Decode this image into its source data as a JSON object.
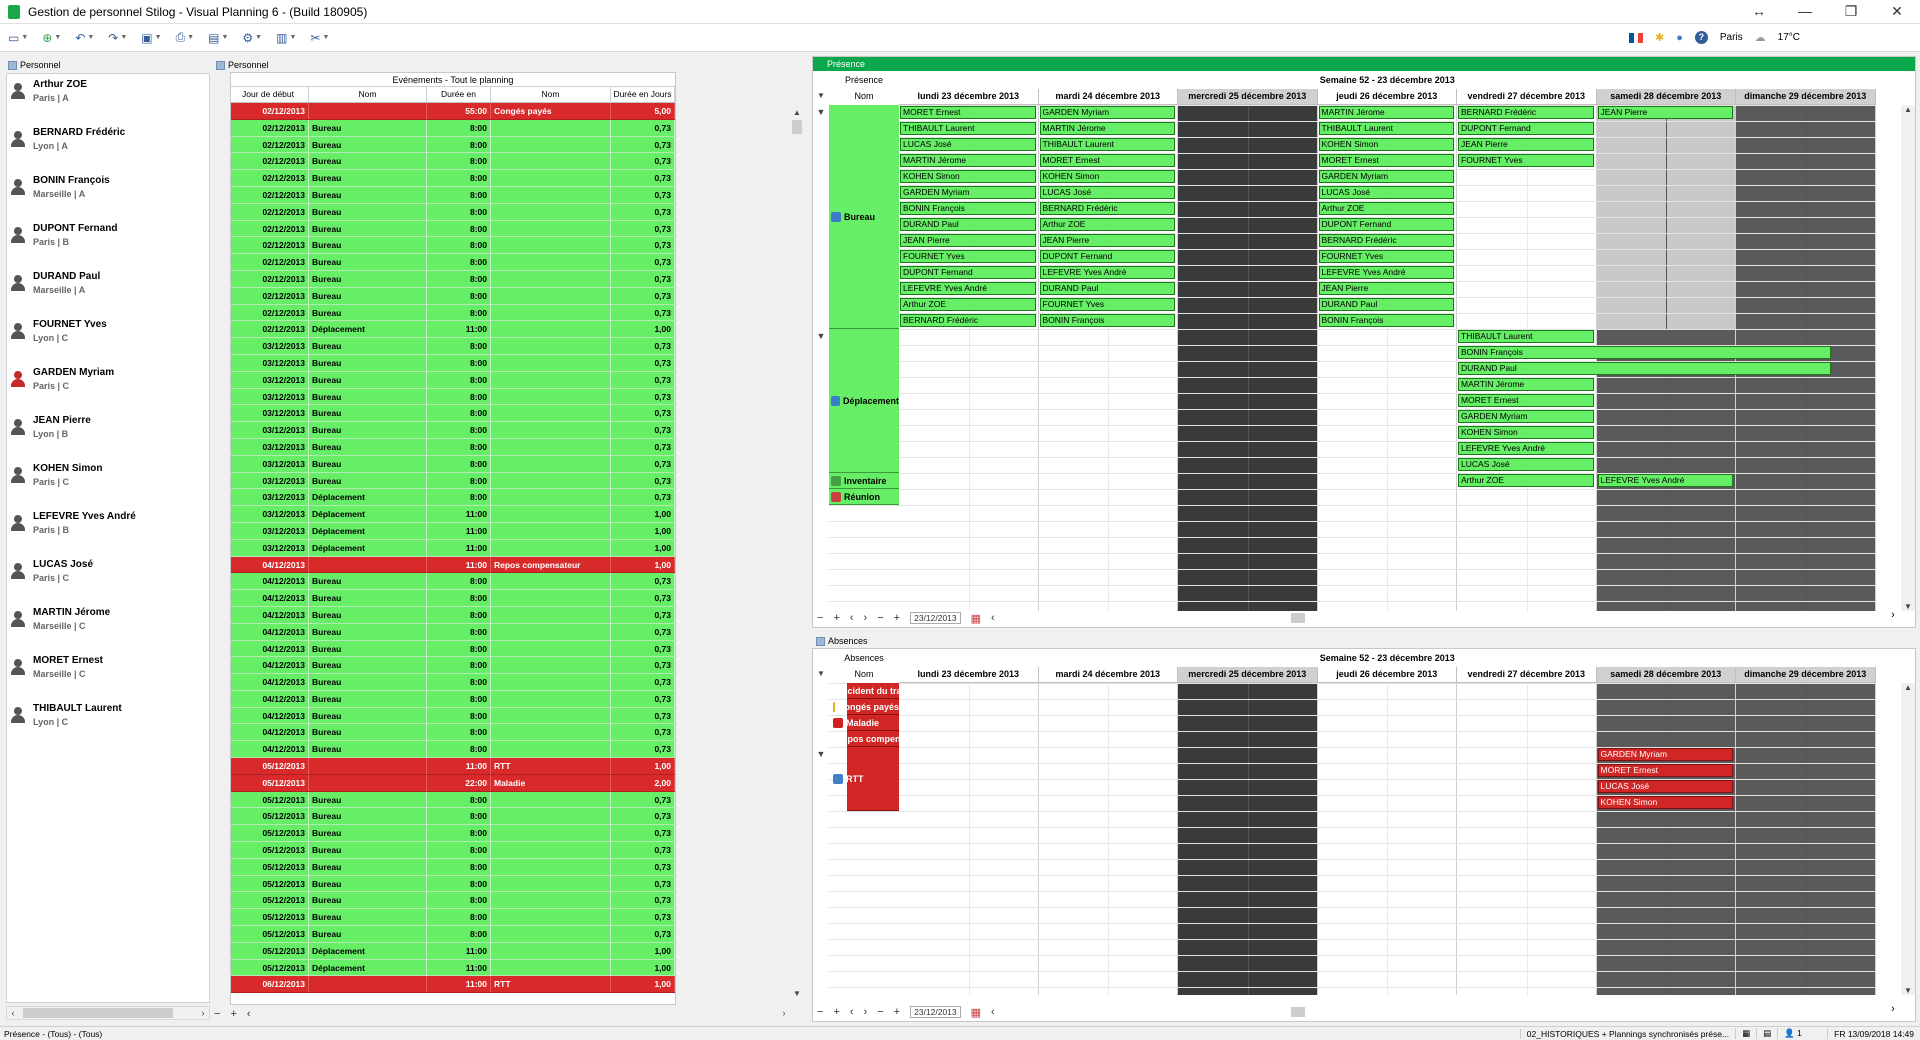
{
  "window": {
    "title": "Gestion de personnel Stilog - Visual Planning 6 - (Build 180905)",
    "controls": [
      "↔",
      "—",
      "❐",
      "✕"
    ]
  },
  "toolbar": {
    "city": "Paris",
    "temperature": "17°C",
    "help": "?"
  },
  "left_panel": {
    "title": "Personnel"
  },
  "personnel": [
    {
      "name": "Arthur ZOE",
      "loc": "Paris | A",
      "red": false
    },
    {
      "name": "BERNARD Frédéric",
      "loc": "Lyon | A",
      "red": false
    },
    {
      "name": "BONIN François",
      "loc": "Marseille | A",
      "red": false
    },
    {
      "name": "DUPONT Fernand",
      "loc": "Paris | B",
      "red": false
    },
    {
      "name": "DURAND Paul",
      "loc": "Marseille | A",
      "red": false
    },
    {
      "name": "FOURNET Yves",
      "loc": "Lyon | C",
      "red": false
    },
    {
      "name": "GARDEN Myriam",
      "loc": "Paris | C",
      "red": true
    },
    {
      "name": "JEAN Pierre",
      "loc": "Lyon | B",
      "red": false
    },
    {
      "name": "KOHEN Simon",
      "loc": "Paris | C",
      "red": false
    },
    {
      "name": "LEFEVRE Yves André",
      "loc": "Paris | B",
      "red": false
    },
    {
      "name": "LUCAS José",
      "loc": "Paris | C",
      "red": false
    },
    {
      "name": "MARTIN Jérome",
      "loc": "Marseille | C",
      "red": false
    },
    {
      "name": "MORET Ernest",
      "loc": "Marseille | C",
      "red": false
    },
    {
      "name": "THIBAULT Laurent",
      "loc": "Lyon | C",
      "red": false
    }
  ],
  "events_panel": {
    "title": "Personnel",
    "table_title": "Evénements - Tout le planning",
    "headers": [
      "Jour de début",
      "Nom",
      "Durée en",
      "Nom",
      "Durée en Jours"
    ],
    "rows": [
      [
        "02/12/2013",
        "",
        "55:00",
        "Congés payés",
        "5,00",
        "r"
      ],
      [
        "02/12/2013",
        "Bureau",
        "8:00",
        "",
        "0,73",
        "g"
      ],
      [
        "02/12/2013",
        "Bureau",
        "8:00",
        "",
        "0,73",
        "g"
      ],
      [
        "02/12/2013",
        "Bureau",
        "8:00",
        "",
        "0,73",
        "g"
      ],
      [
        "02/12/2013",
        "Bureau",
        "8:00",
        "",
        "0,73",
        "g"
      ],
      [
        "02/12/2013",
        "Bureau",
        "8:00",
        "",
        "0,73",
        "g"
      ],
      [
        "02/12/2013",
        "Bureau",
        "8:00",
        "",
        "0,73",
        "g"
      ],
      [
        "02/12/2013",
        "Bureau",
        "8:00",
        "",
        "0,73",
        "g"
      ],
      [
        "02/12/2013",
        "Bureau",
        "8:00",
        "",
        "0,73",
        "g"
      ],
      [
        "02/12/2013",
        "Bureau",
        "8:00",
        "",
        "0,73",
        "g"
      ],
      [
        "02/12/2013",
        "Bureau",
        "8:00",
        "",
        "0,73",
        "g"
      ],
      [
        "02/12/2013",
        "Bureau",
        "8:00",
        "",
        "0,73",
        "g"
      ],
      [
        "02/12/2013",
        "Bureau",
        "8:00",
        "",
        "0,73",
        "g"
      ],
      [
        "02/12/2013",
        "Déplacement",
        "11:00",
        "",
        "1,00",
        "g"
      ],
      [
        "03/12/2013",
        "Bureau",
        "8:00",
        "",
        "0,73",
        "g"
      ],
      [
        "03/12/2013",
        "Bureau",
        "8:00",
        "",
        "0,73",
        "g"
      ],
      [
        "03/12/2013",
        "Bureau",
        "8:00",
        "",
        "0,73",
        "g"
      ],
      [
        "03/12/2013",
        "Bureau",
        "8:00",
        "",
        "0,73",
        "g"
      ],
      [
        "03/12/2013",
        "Bureau",
        "8:00",
        "",
        "0,73",
        "g"
      ],
      [
        "03/12/2013",
        "Bureau",
        "8:00",
        "",
        "0,73",
        "g"
      ],
      [
        "03/12/2013",
        "Bureau",
        "8:00",
        "",
        "0,73",
        "g"
      ],
      [
        "03/12/2013",
        "Bureau",
        "8:00",
        "",
        "0,73",
        "g"
      ],
      [
        "03/12/2013",
        "Bureau",
        "8:00",
        "",
        "0,73",
        "g"
      ],
      [
        "03/12/2013",
        "Déplacement",
        "8:00",
        "",
        "0,73",
        "g"
      ],
      [
        "03/12/2013",
        "Déplacement",
        "11:00",
        "",
        "1,00",
        "g"
      ],
      [
        "03/12/2013",
        "Déplacement",
        "11:00",
        "",
        "1,00",
        "g"
      ],
      [
        "03/12/2013",
        "Déplacement",
        "11:00",
        "",
        "1,00",
        "g"
      ],
      [
        "04/12/2013",
        "",
        "11:00",
        "Repos compensateur",
        "1,00",
        "r"
      ],
      [
        "04/12/2013",
        "Bureau",
        "8:00",
        "",
        "0,73",
        "g"
      ],
      [
        "04/12/2013",
        "Bureau",
        "8:00",
        "",
        "0,73",
        "g"
      ],
      [
        "04/12/2013",
        "Bureau",
        "8:00",
        "",
        "0,73",
        "g"
      ],
      [
        "04/12/2013",
        "Bureau",
        "8:00",
        "",
        "0,73",
        "g"
      ],
      [
        "04/12/2013",
        "Bureau",
        "8:00",
        "",
        "0,73",
        "g"
      ],
      [
        "04/12/2013",
        "Bureau",
        "8:00",
        "",
        "0,73",
        "g"
      ],
      [
        "04/12/2013",
        "Bureau",
        "8:00",
        "",
        "0,73",
        "g"
      ],
      [
        "04/12/2013",
        "Bureau",
        "8:00",
        "",
        "0,73",
        "g"
      ],
      [
        "04/12/2013",
        "Bureau",
        "8:00",
        "",
        "0,73",
        "g"
      ],
      [
        "04/12/2013",
        "Bureau",
        "8:00",
        "",
        "0,73",
        "g"
      ],
      [
        "04/12/2013",
        "Bureau",
        "8:00",
        "",
        "0,73",
        "g"
      ],
      [
        "05/12/2013",
        "",
        "11:00",
        "RTT",
        "1,00",
        "r"
      ],
      [
        "05/12/2013",
        "",
        "22:00",
        "Maladie",
        "2,00",
        "r"
      ],
      [
        "05/12/2013",
        "Bureau",
        "8:00",
        "",
        "0,73",
        "g"
      ],
      [
        "05/12/2013",
        "Bureau",
        "8:00",
        "",
        "0,73",
        "g"
      ],
      [
        "05/12/2013",
        "Bureau",
        "8:00",
        "",
        "0,73",
        "g"
      ],
      [
        "05/12/2013",
        "Bureau",
        "8:00",
        "",
        "0,73",
        "g"
      ],
      [
        "05/12/2013",
        "Bureau",
        "8:00",
        "",
        "0,73",
        "g"
      ],
      [
        "05/12/2013",
        "Bureau",
        "8:00",
        "",
        "0,73",
        "g"
      ],
      [
        "05/12/2013",
        "Bureau",
        "8:00",
        "",
        "0,73",
        "g"
      ],
      [
        "05/12/2013",
        "Bureau",
        "8:00",
        "",
        "0,73",
        "g"
      ],
      [
        "05/12/2013",
        "Bureau",
        "8:00",
        "",
        "0,73",
        "g"
      ],
      [
        "05/12/2013",
        "Déplacement",
        "11:00",
        "",
        "1,00",
        "g"
      ],
      [
        "05/12/2013",
        "Déplacement",
        "11:00",
        "",
        "1,00",
        "g"
      ],
      [
        "06/12/2013",
        "",
        "11:00",
        "RTT",
        "1,00",
        "r"
      ]
    ]
  },
  "presence": {
    "title": "Présence",
    "week_label": "Semaine 52 - 23 décembre 2013",
    "resource_header": "Présence",
    "name_header": "Nom",
    "days": [
      "lundi 23 décembre 2013",
      "mardi 24 décembre 2013",
      "mercredi 25 décembre 2013",
      "jeudi 26 décembre 2013",
      "vendredi 27 décembre 2013",
      "samedi 28 décembre 2013",
      "dimanche 29 décembre 2013"
    ],
    "categories": [
      {
        "label": "Bureau",
        "color": "#3a7dc8"
      },
      {
        "label": "Déplacement",
        "color": "#3a7dc8"
      },
      {
        "label": "Inventaire",
        "color": "#46a046"
      },
      {
        "label": "Réunion",
        "color": "#c84040"
      }
    ],
    "bureau": {
      "mon": [
        "MORET Ernest",
        "THIBAULT Laurent",
        "LUCAS José",
        "MARTIN Jérome",
        "KOHEN Simon",
        "GARDEN Myriam",
        "BONIN François",
        "DURAND Paul",
        "JEAN Pierre",
        "FOURNET Yves",
        "DUPONT Fernand",
        "LEFEVRE Yves André",
        "Arthur ZOE",
        "BERNARD Frédéric"
      ],
      "tue": [
        "GARDEN Myriam",
        "MARTIN Jérome",
        "THIBAULT Laurent",
        "MORET Ernest",
        "KOHEN Simon",
        "LUCAS José",
        "BERNARD Frédéric",
        "Arthur ZOE",
        "JEAN Pierre",
        "DUPONT Fernand",
        "LEFEVRE Yves André",
        "DURAND Paul",
        "FOURNET Yves",
        "BONIN François"
      ],
      "thu": [
        "MARTIN Jérome",
        "THIBAULT Laurent",
        "KOHEN Simon",
        "MORET Ernest",
        "GARDEN Myriam",
        "LUCAS José",
        "Arthur ZOE",
        "DUPONT Fernand",
        "BERNARD Frédéric",
        "FOURNET Yves",
        "LEFEVRE Yves André",
        "JEAN Pierre",
        "DURAND Paul",
        "BONIN François"
      ],
      "fri": [
        "BERNARD Frédéric",
        "DUPONT Fernand",
        "JEAN Pierre",
        "FOURNET Yves"
      ],
      "sat": [
        "JEAN Pierre"
      ]
    },
    "deplacement": {
      "fri": [
        "THIBAULT Laurent",
        "BONIN François",
        "DURAND Paul",
        "MARTIN Jérome",
        "MORET Ernest",
        "GARDEN Myriam",
        "KOHEN Simon",
        "LEFEVRE Yves André",
        "LUCAS José"
      ]
    },
    "inventaire": {
      "fri": "Arthur ZOE",
      "sat": "LEFEVRE Yves André"
    },
    "nav_date": "23/12/2013"
  },
  "absences": {
    "title": "Absences",
    "week_label": "Semaine 52 - 23 décembre 2013",
    "resource_header": "Absences",
    "name_header": "Nom",
    "days": [
      "lundi 23 décembre 2013",
      "mardi 24 décembre 2013",
      "mercredi 25 décembre 2013",
      "jeudi 26 décembre 2013",
      "vendredi 27 décembre 2013",
      "samedi 28 décembre 2013",
      "dimanche 29 décembre 2013"
    ],
    "categories": [
      {
        "label": "Accident du tra",
        "color": "#202020"
      },
      {
        "label": "Congés payés",
        "color": "#e8b020"
      },
      {
        "label": "Maladie",
        "color": "#d02020"
      },
      {
        "label": "Repos compen",
        "color": "#40a040"
      },
      {
        "label": "RTT",
        "color": "#4080c8"
      }
    ],
    "rtt_sat": [
      "GARDEN Myriam",
      "MORET Ernest",
      "LUCAS José",
      "KOHEN Simon"
    ],
    "nav_date": "23/12/2013"
  },
  "statusbar": {
    "left": "Présence - (Tous) - (Tous)",
    "sync": "02_HISTORIQUES + Plannings synchronisés prése...",
    "users": "1",
    "datetime": "FR 13/09/2018 14:49"
  }
}
